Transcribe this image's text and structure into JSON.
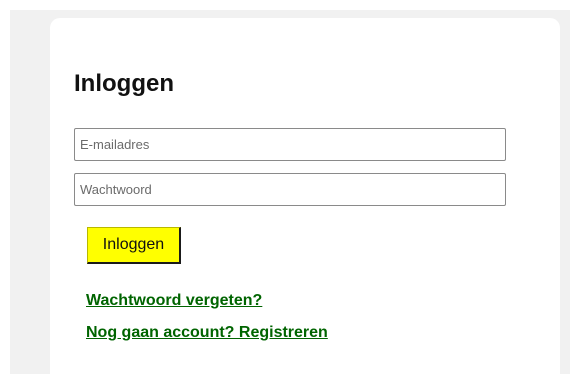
{
  "login": {
    "title": "Inloggen",
    "email_placeholder": "E-mailadres",
    "email_value": "",
    "password_placeholder": "Wachtwoord",
    "password_value": "",
    "button_label": "Inloggen",
    "forgot_password_link": "Wachtwoord vergeten?",
    "register_link": "Nog gaan account? Registreren"
  },
  "colors": {
    "page_background": "#f1f1f1",
    "card_background": "#ffffff",
    "button_background": "#ffff00",
    "link_color": "#006400"
  }
}
